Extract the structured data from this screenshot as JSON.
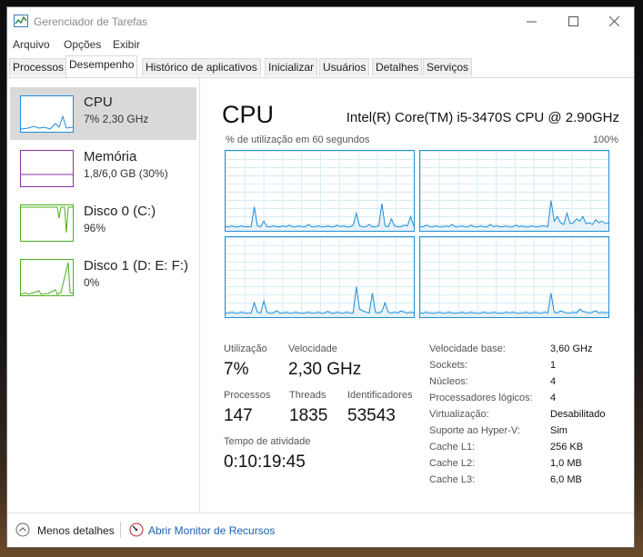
{
  "window": {
    "title": "Gerenciador de Tarefas"
  },
  "menu": [
    "Arquivo",
    "Opções",
    "Exibir"
  ],
  "tabs": [
    "Processos",
    "Desempenho",
    "Histórico de aplicativos",
    "Inicializar",
    "Usuários",
    "Detalhes",
    "Serviços"
  ],
  "active_tab": "Desempenho",
  "sidebar": [
    {
      "name": "CPU",
      "value": "7% 2,30 GHz",
      "color": "#1f8ed6"
    },
    {
      "name": "Memória",
      "value": "1,8/6,0 GB (30%)",
      "color": "#8b2fa8"
    },
    {
      "name": "Disco 0 (C:)",
      "value": "96%",
      "color": "#4caf1e"
    },
    {
      "name": "Disco 1 (D: E: F:)",
      "value": "0%",
      "color": "#4caf1e"
    }
  ],
  "main": {
    "title": "CPU",
    "model": "Intel(R) Core(TM) i5-3470S CPU @ 2.90GHz",
    "graph_caption": "% de utilização em 60 segundos",
    "graph_max": "100%"
  },
  "stats": {
    "utilizacao": {
      "label": "Utilização",
      "value": "7%"
    },
    "velocidade": {
      "label": "Velocidade",
      "value": "2,30 GHz"
    },
    "processos": {
      "label": "Processos",
      "value": "147"
    },
    "threads": {
      "label": "Threads",
      "value": "1835"
    },
    "identificadores": {
      "label": "Identificadores",
      "value": "53543"
    },
    "tempo": {
      "label": "Tempo de atividade",
      "value": "0:10:19:45"
    }
  },
  "specs": [
    {
      "label": "Velocidade base:",
      "value": "3,60 GHz"
    },
    {
      "label": "Sockets:",
      "value": "1"
    },
    {
      "label": "Núcleos:",
      "value": "4"
    },
    {
      "label": "Processadores lógicos:",
      "value": "4"
    },
    {
      "label": "Virtualização:",
      "value": "Desabilitado"
    },
    {
      "label": "Suporte ao Hyper-V:",
      "value": "Sim"
    },
    {
      "label": "Cache L1:",
      "value": "256 KB"
    },
    {
      "label": "Cache L2:",
      "value": "1,0 MB"
    },
    {
      "label": "Cache L3:",
      "value": "6,0 MB"
    }
  ],
  "footer": {
    "less_details": "Menos detalhes",
    "resource_monitor": "Abrir Monitor de Recursos"
  },
  "colors": {
    "cpu": "#1f8ed6",
    "memory": "#8b2fa8",
    "disk": "#4caf1e",
    "link": "#1a5fb4"
  },
  "core_graphs": [
    [
      5,
      5,
      6,
      5,
      5,
      6,
      5,
      5,
      5,
      30,
      6,
      5,
      12,
      5,
      5,
      6,
      5,
      5,
      6,
      5,
      7,
      5,
      5,
      6,
      5,
      5,
      8,
      5,
      5,
      6,
      5,
      5,
      6,
      5,
      5,
      7,
      5,
      6,
      5,
      5,
      7,
      22,
      6,
      5,
      5,
      8,
      5,
      5,
      6,
      34,
      6,
      5,
      15,
      6,
      5,
      5,
      7,
      6,
      18,
      6
    ],
    [
      5,
      5,
      7,
      5,
      5,
      6,
      5,
      5,
      6,
      5,
      8,
      5,
      5,
      6,
      5,
      5,
      7,
      5,
      5,
      6,
      5,
      5,
      8,
      5,
      6,
      5,
      5,
      6,
      5,
      5,
      7,
      5,
      6,
      5,
      5,
      6,
      5,
      5,
      6,
      6,
      5,
      38,
      12,
      18,
      10,
      8,
      22,
      9,
      10,
      15,
      12,
      18,
      9,
      10,
      8,
      14,
      10,
      12,
      9,
      10
    ],
    [
      5,
      5,
      6,
      5,
      5,
      6,
      5,
      5,
      5,
      18,
      6,
      5,
      20,
      6,
      5,
      5,
      8,
      5,
      5,
      6,
      5,
      5,
      6,
      5,
      5,
      5,
      6,
      5,
      5,
      6,
      5,
      5,
      7,
      5,
      5,
      6,
      5,
      5,
      6,
      5,
      5,
      38,
      10,
      8,
      6,
      5,
      30,
      6,
      5,
      7,
      18,
      6,
      5,
      6,
      5,
      8,
      6,
      5,
      6,
      5
    ],
    [
      5,
      5,
      6,
      5,
      5,
      5,
      6,
      5,
      5,
      6,
      5,
      5,
      5,
      6,
      5,
      5,
      6,
      5,
      5,
      5,
      6,
      5,
      5,
      6,
      5,
      5,
      5,
      6,
      5,
      6,
      5,
      5,
      5,
      6,
      5,
      5,
      6,
      5,
      5,
      6,
      5,
      30,
      6,
      5,
      8,
      6,
      5,
      5,
      6,
      5,
      10,
      7,
      6,
      5,
      6,
      8,
      5,
      6,
      5,
      6
    ]
  ]
}
